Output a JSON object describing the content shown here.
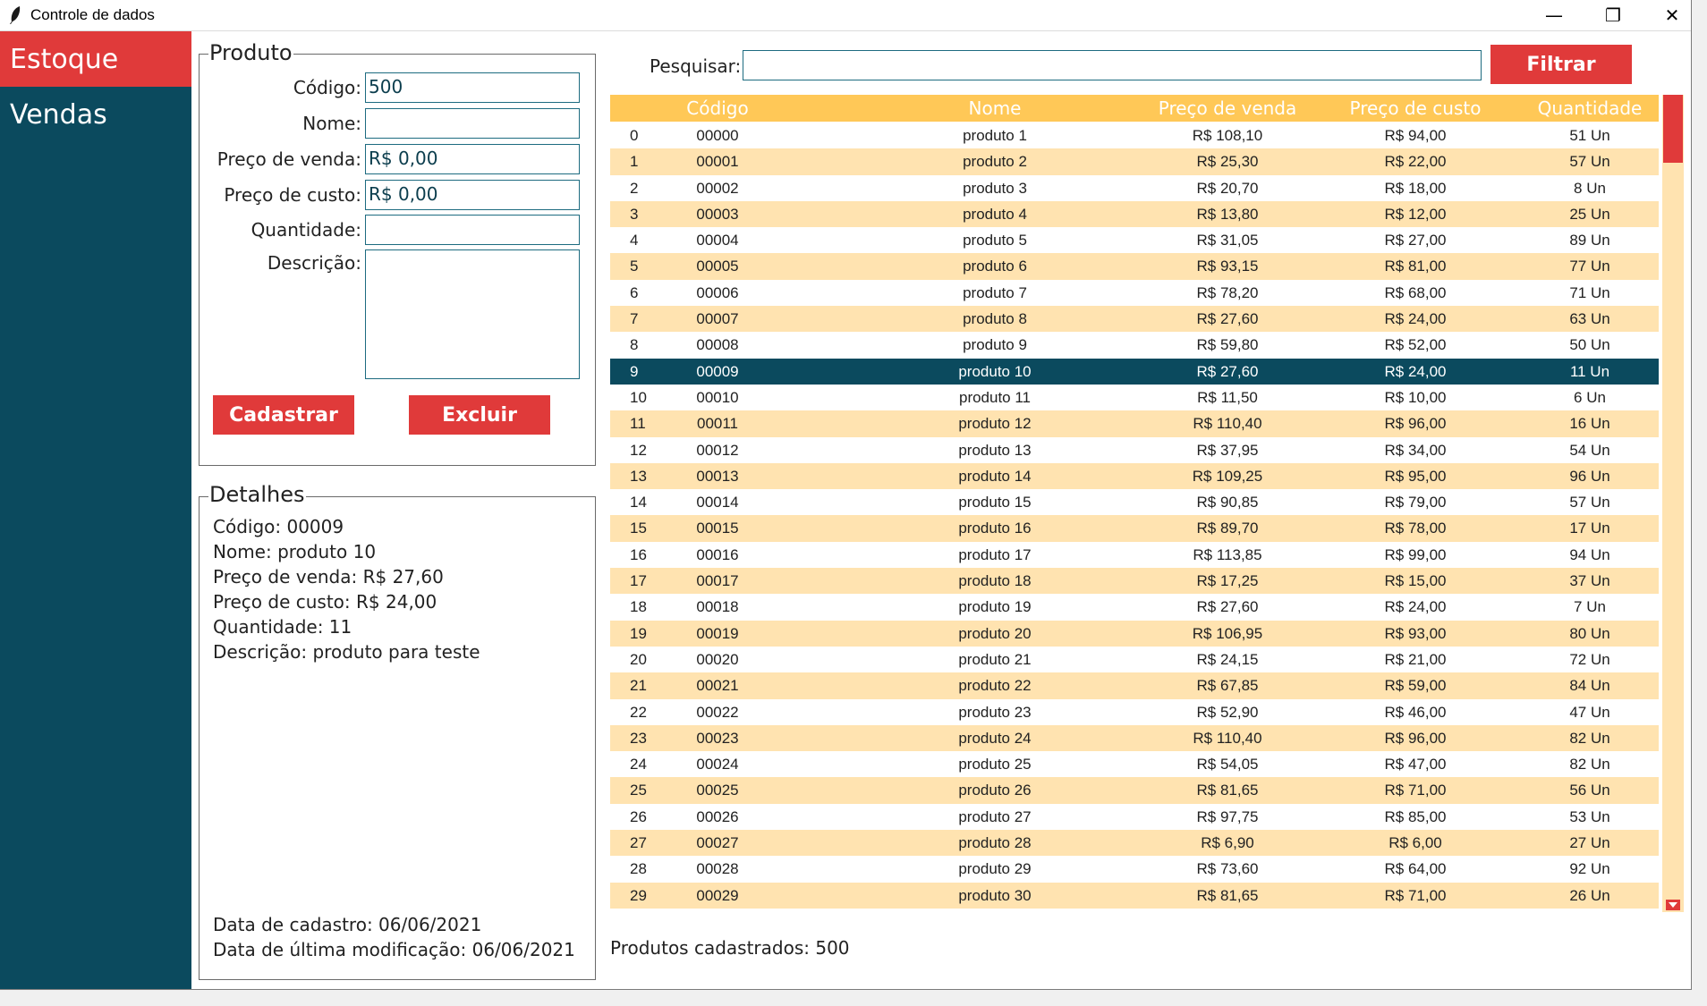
{
  "window": {
    "title": "Controle de dados",
    "minimize": "—",
    "restore": "❐",
    "close": "✕"
  },
  "sidebar": {
    "items": [
      {
        "label": "Estoque",
        "active": true
      },
      {
        "label": "Vendas",
        "active": false
      }
    ]
  },
  "produto": {
    "title": "Produto",
    "labels": {
      "codigo": "Código:",
      "nome": "Nome:",
      "preco_venda": "Preço de venda:",
      "preco_custo": "Preço de custo:",
      "quantidade": "Quantidade:",
      "descricao": "Descrição:"
    },
    "values": {
      "codigo": "500",
      "nome": "",
      "preco_venda": "R$ 0,00",
      "preco_custo": "R$ 0,00",
      "quantidade": "",
      "descricao": ""
    },
    "buttons": {
      "cadastrar": "Cadastrar",
      "excluir": "Excluir"
    }
  },
  "detalhes": {
    "title": "Detalhes",
    "lines": [
      "Código: 00009",
      "Nome: produto 10",
      "Preço de venda: R$ 27,60",
      "Preço de custo: R$ 24,00",
      "Quantidade: 11",
      "Descrição: produto para teste"
    ],
    "data_cadastro": "Data de cadastro: 06/06/2021",
    "data_modificacao": "Data de última modificação: 06/06/2021"
  },
  "search": {
    "label": "Pesquisar:",
    "value": "",
    "button": "Filtrar"
  },
  "table": {
    "headers": [
      "Código",
      "Nome",
      "Preço de venda",
      "Preço de custo",
      "Quantidade"
    ],
    "selected_index": 9,
    "rows": [
      [
        "0",
        "00000",
        "produto 1",
        "R$ 108,10",
        "R$ 94,00",
        "51 Un"
      ],
      [
        "1",
        "00001",
        "produto 2",
        "R$ 25,30",
        "R$ 22,00",
        "57 Un"
      ],
      [
        "2",
        "00002",
        "produto 3",
        "R$ 20,70",
        "R$ 18,00",
        "8 Un"
      ],
      [
        "3",
        "00003",
        "produto 4",
        "R$ 13,80",
        "R$ 12,00",
        "25 Un"
      ],
      [
        "4",
        "00004",
        "produto 5",
        "R$ 31,05",
        "R$ 27,00",
        "89 Un"
      ],
      [
        "5",
        "00005",
        "produto 6",
        "R$ 93,15",
        "R$ 81,00",
        "77 Un"
      ],
      [
        "6",
        "00006",
        "produto 7",
        "R$ 78,20",
        "R$ 68,00",
        "71 Un"
      ],
      [
        "7",
        "00007",
        "produto 8",
        "R$ 27,60",
        "R$ 24,00",
        "63 Un"
      ],
      [
        "8",
        "00008",
        "produto 9",
        "R$ 59,80",
        "R$ 52,00",
        "50 Un"
      ],
      [
        "9",
        "00009",
        "produto 10",
        "R$ 27,60",
        "R$ 24,00",
        "11 Un"
      ],
      [
        "10",
        "00010",
        "produto 11",
        "R$ 11,50",
        "R$ 10,00",
        "6 Un"
      ],
      [
        "11",
        "00011",
        "produto 12",
        "R$ 110,40",
        "R$ 96,00",
        "16 Un"
      ],
      [
        "12",
        "00012",
        "produto 13",
        "R$ 37,95",
        "R$ 34,00",
        "54 Un"
      ],
      [
        "13",
        "00013",
        "produto 14",
        "R$ 109,25",
        "R$ 95,00",
        "96 Un"
      ],
      [
        "14",
        "00014",
        "produto 15",
        "R$ 90,85",
        "R$ 79,00",
        "57 Un"
      ],
      [
        "15",
        "00015",
        "produto 16",
        "R$ 89,70",
        "R$ 78,00",
        "17 Un"
      ],
      [
        "16",
        "00016",
        "produto 17",
        "R$ 113,85",
        "R$ 99,00",
        "94 Un"
      ],
      [
        "17",
        "00017",
        "produto 18",
        "R$ 17,25",
        "R$ 15,00",
        "37 Un"
      ],
      [
        "18",
        "00018",
        "produto 19",
        "R$ 27,60",
        "R$ 24,00",
        "7 Un"
      ],
      [
        "19",
        "00019",
        "produto 20",
        "R$ 106,95",
        "R$ 93,00",
        "80 Un"
      ],
      [
        "20",
        "00020",
        "produto 21",
        "R$ 24,15",
        "R$ 21,00",
        "72 Un"
      ],
      [
        "21",
        "00021",
        "produto 22",
        "R$ 67,85",
        "R$ 59,00",
        "84 Un"
      ],
      [
        "22",
        "00022",
        "produto 23",
        "R$ 52,90",
        "R$ 46,00",
        "47 Un"
      ],
      [
        "23",
        "00023",
        "produto 24",
        "R$ 110,40",
        "R$ 96,00",
        "82 Un"
      ],
      [
        "24",
        "00024",
        "produto 25",
        "R$ 54,05",
        "R$ 47,00",
        "82 Un"
      ],
      [
        "25",
        "00025",
        "produto 26",
        "R$ 81,65",
        "R$ 71,00",
        "56 Un"
      ],
      [
        "26",
        "00026",
        "produto 27",
        "R$ 97,75",
        "R$ 85,00",
        "53 Un"
      ],
      [
        "27",
        "00027",
        "produto 28",
        "R$ 6,90",
        "R$ 6,00",
        "27 Un"
      ],
      [
        "28",
        "00028",
        "produto 29",
        "R$ 73,60",
        "R$ 64,00",
        "92 Un"
      ],
      [
        "29",
        "00029",
        "produto 30",
        "R$ 81,65",
        "R$ 71,00",
        "26 Un"
      ]
    ]
  },
  "footer": {
    "count": "Produtos cadastrados: 500"
  },
  "colors": {
    "sidebar": "#0b4a5e",
    "accent_red": "#e03a3a",
    "header_yellow": "#ffc857",
    "row_alt": "#ffe3b0",
    "selected_row": "#0b4a5e"
  }
}
